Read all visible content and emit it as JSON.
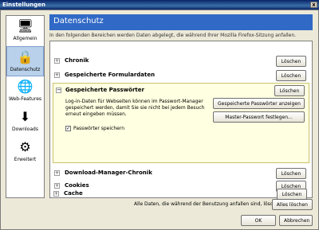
{
  "window": {
    "title": "Einstellungen",
    "close_glyph": "x"
  },
  "sidebar": {
    "items": [
      {
        "label": "Allgemein",
        "icon": "computer-icon",
        "glyph": "🖥"
      },
      {
        "label": "Datenschutz",
        "icon": "lock-icon",
        "glyph": "🔒",
        "active": true
      },
      {
        "label": "Web-Features",
        "icon": "globe-icon",
        "glyph": "🌐"
      },
      {
        "label": "Downloads",
        "icon": "downloads-icon",
        "glyph": "⬇"
      },
      {
        "label": "Erweitert",
        "icon": "gear-icon",
        "glyph": "⚙"
      }
    ]
  },
  "header": {
    "title": "Datenschutz"
  },
  "description": "In den folgenden Bereichen werden Daten abgelegt, die während Ihrer Mozilla Firefox-Sitzung anfallen.",
  "sections": [
    {
      "name": "Chronik",
      "button": "Löschen"
    },
    {
      "name": "Gespeicherte Formulardaten",
      "button": "Löschen"
    },
    {
      "name": "Download-Manager-Chronik",
      "button": "Löschen"
    },
    {
      "name": "Cookies",
      "button": "Löschen"
    },
    {
      "name": "Cache",
      "button": "Löschen"
    }
  ],
  "passwords": {
    "name": "Gespeicherte Passwörter",
    "button": "Löschen",
    "text": "Log-in-Daten für Webseiten können im Passwort-Manager gespeichert werden, damit Sie sie nicht bei jedem Besuch erneut eingeben müssen.",
    "show_button": "Gespeicherte Passwörter anzeigen",
    "master_button": "Master-Passwort festlegen...",
    "checkbox_label": "Passwörter speichern",
    "checkbox_checked": true,
    "check_glyph": "✓"
  },
  "footer": {
    "text": "Alle Daten, die während der Benutzung anfallen sind, löschen:",
    "clear_all": "Alles löschen",
    "ok": "OK",
    "cancel": "Abbrechen"
  },
  "expand_glyphs": {
    "plus": "+",
    "minus": "−"
  },
  "colors": {
    "header_bg": "#3169c6",
    "expanded_bg": "#ffffe1",
    "active_item_bg": "#b9d1ea"
  }
}
